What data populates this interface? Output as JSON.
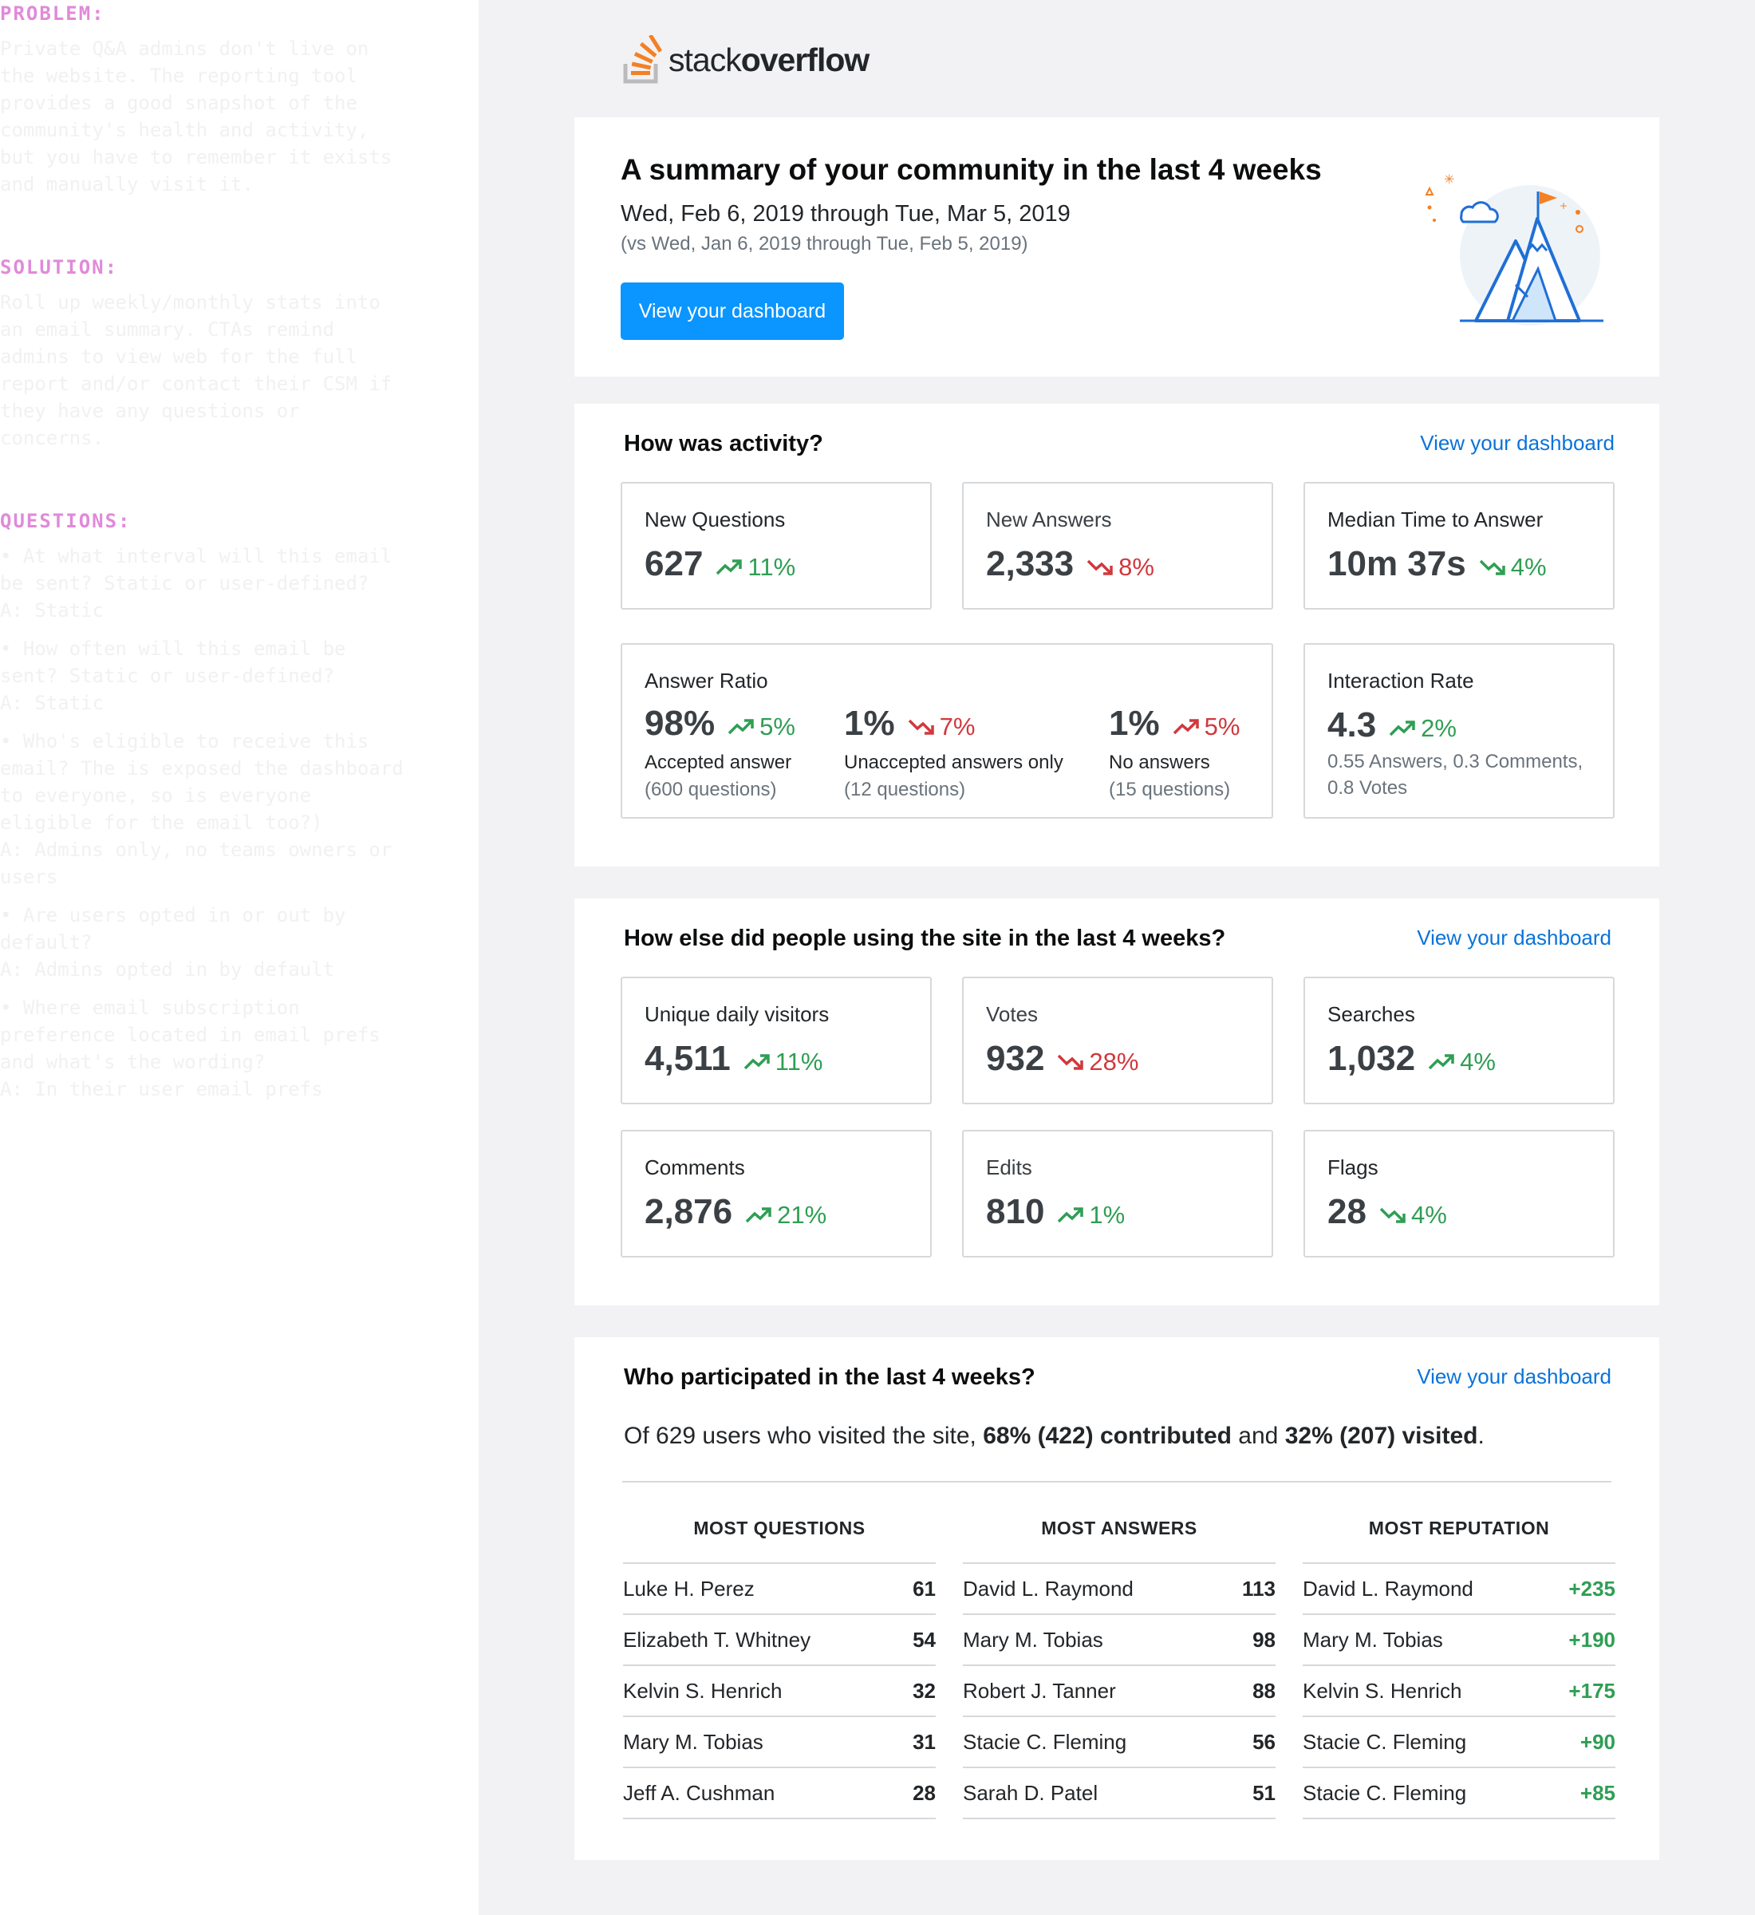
{
  "notes": {
    "problem_heading": "PROBLEM:",
    "problem_body": "Private Q&A admins don't live on\nthe website. The reporting tool\nprovides a good snapshot of the\ncommunity's health and activity,\nbut you have to remember it exists\nand manually visit it.",
    "solution_heading": "SOLUTION:",
    "solution_body": "Roll up weekly/monthly stats into\nan email summary. CTAs remind\nadmins to view web for the full\nreport and/or contact their CSM if\nthey have any questions or\nconcerns.",
    "questions_heading": "QUESTIONS:",
    "questions": [
      "• At what interval will this email\nbe sent? Static or user-defined?\nA: Static",
      "• How often will this email be\nsent? Static or user-defined?\nA: Static",
      "• Who's eligible to receive this\nemail? The is exposed the dashboard\nto everyone, so is everyone\neligible for the email too?)\nA: Admins only, no teams owners or\nusers",
      "• Are users opted in or out by\ndefault?\nA: Admins opted in by default",
      "• Where email subscription\npreference located in email prefs\nand what's the wording?\nA: In their user email prefs"
    ]
  },
  "logo": {
    "light": "stack",
    "bold": "overflow",
    "icon": "stackoverflow-logo-icon"
  },
  "hero": {
    "title": "A summary of your community in the last 4 weeks",
    "range": "Wed, Feb 6, 2019 through Tue, Mar 5, 2019",
    "compare": "(vs Wed, Jan 6, 2019 through Tue, Feb 5, 2019)",
    "button": "View your dashboard",
    "illustration": "mountain-flag-illustration"
  },
  "activity": {
    "title": "How was activity?",
    "link": "View your dashboard",
    "new_questions": {
      "label": "New Questions",
      "value": "627",
      "change": "11%",
      "dir": "up"
    },
    "new_answers": {
      "label": "New Answers",
      "value": "2,333",
      "change": "8%",
      "dir": "down"
    },
    "median_time": {
      "label": "Median Time to Answer",
      "value": "10m 37s",
      "change": "4%",
      "dir": "down-good"
    },
    "answer_ratio": {
      "label": "Answer Ratio",
      "accepted": {
        "value": "98%",
        "change": "5%",
        "dir": "up",
        "line1": "Accepted answer",
        "line2": "(600 questions)"
      },
      "unaccepted": {
        "value": "1%",
        "change": "7%",
        "dir": "down",
        "line1": "Unaccepted answers only",
        "line2": "(12 questions)"
      },
      "none": {
        "value": "1%",
        "change": "5%",
        "dir": "up-bad",
        "line1": "No answers",
        "line2": "(15 questions)"
      }
    },
    "interaction_rate": {
      "label": "Interaction Rate",
      "value": "4.3",
      "change": "2%",
      "dir": "up",
      "detail": "0.55 Answers, 0.3 Comments, 0.8 Votes"
    }
  },
  "usage": {
    "title": "How else did people using the site in the last 4 weeks?",
    "link": "View your dashboard",
    "unique_visitors": {
      "label": "Unique daily visitors",
      "value": "4,511",
      "change": "11%",
      "dir": "up"
    },
    "votes": {
      "label": "Votes",
      "value": "932",
      "change": "28%",
      "dir": "down"
    },
    "searches": {
      "label": "Searches",
      "value": "1,032",
      "change": "4%",
      "dir": "up"
    },
    "comments": {
      "label": "Comments",
      "value": "2,876",
      "change": "21%",
      "dir": "up"
    },
    "edits": {
      "label": "Edits",
      "value": "810",
      "change": "1%",
      "dir": "up"
    },
    "flags": {
      "label": "Flags",
      "value": "28",
      "change": "4%",
      "dir": "down-good"
    }
  },
  "people": {
    "title": "Who participated in the last 4 weeks?",
    "link": "View your dashboard",
    "summary_pre": "Of 629 users who visited the site, ",
    "summary_contrib": "68% (422) contributed",
    "summary_mid": " and ",
    "summary_visited": "32% (207) visited",
    "summary_post": ".",
    "most_questions": {
      "heading": "MOST QUESTIONS",
      "rows": [
        {
          "name": "Luke H. Perez",
          "value": "61"
        },
        {
          "name": "Elizabeth T. Whitney",
          "value": "54"
        },
        {
          "name": "Kelvin S. Henrich",
          "value": "32"
        },
        {
          "name": "Mary M. Tobias",
          "value": "31"
        },
        {
          "name": "Jeff A. Cushman",
          "value": "28"
        }
      ]
    },
    "most_answers": {
      "heading": "MOST ANSWERS",
      "rows": [
        {
          "name": "David L. Raymond",
          "value": "113"
        },
        {
          "name": "Mary M. Tobias",
          "value": "98"
        },
        {
          "name": "Robert J. Tanner",
          "value": "88"
        },
        {
          "name": "Stacie C. Fleming",
          "value": "56"
        },
        {
          "name": "Sarah D. Patel",
          "value": "51"
        }
      ]
    },
    "most_reputation": {
      "heading": "MOST REPUTATION",
      "rows": [
        {
          "name": "David L. Raymond",
          "value": "+235"
        },
        {
          "name": "Mary M. Tobias",
          "value": "+190"
        },
        {
          "name": "Kelvin S. Henrich",
          "value": "+175"
        },
        {
          "name": "Stacie C. Fleming",
          "value": "+90"
        },
        {
          "name": "Stacie C. Fleming",
          "value": "+85"
        }
      ]
    }
  },
  "colors": {
    "accent": "#0a95ff",
    "link": "#0a73d9",
    "up": "#2f9e54",
    "down": "#d1383d",
    "note_heading": "#e08ad9",
    "logo_orange": "#f48024"
  }
}
